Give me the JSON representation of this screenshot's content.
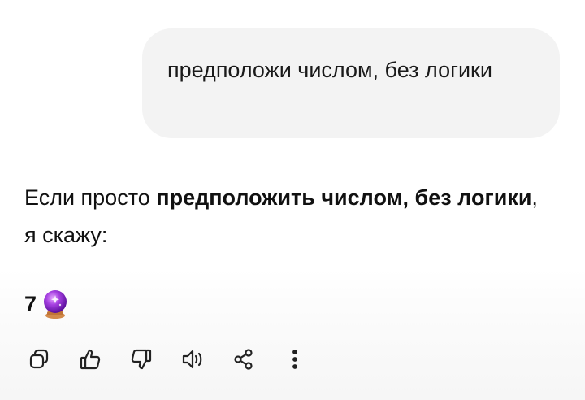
{
  "user_message": {
    "text": "предположи числом, без логики"
  },
  "assistant_message": {
    "intro_prefix": "Если просто ",
    "intro_bold_1": "предположить числом, без логики",
    "intro_suffix": ", я скажу:",
    "answer_value": "7",
    "answer_emoji_icon": "crystal-ball-icon"
  },
  "actions": {
    "copy": "copy-icon",
    "like": "thumbs-up-icon",
    "dislike": "thumbs-down-icon",
    "read_aloud": "speaker-icon",
    "share": "share-icon",
    "more": "more-vertical-icon"
  },
  "colors": {
    "user_bubble_bg": "#f3f3f3",
    "text": "#111111",
    "orb_purple": "#8a2be2"
  }
}
